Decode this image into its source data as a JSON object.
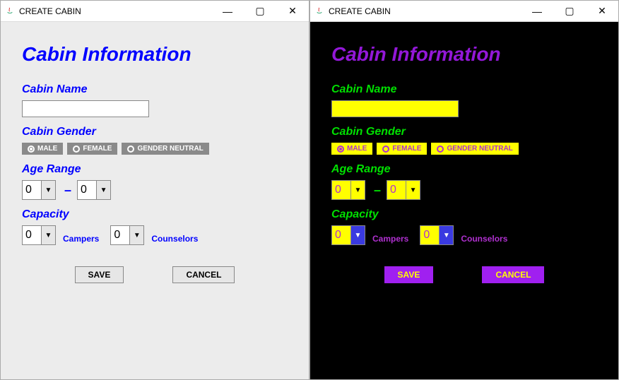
{
  "window": {
    "title": "CREATE CABIN"
  },
  "heading": "Cabin Information",
  "labels": {
    "cabin_name": "Cabin Name",
    "cabin_gender": "Cabin Gender",
    "age_range": "Age Range",
    "capacity": "Capacity",
    "campers": "Campers",
    "counselors": "Counselors",
    "dash": "–"
  },
  "inputs": {
    "cabin_name_value": ""
  },
  "gender_options": {
    "male": "MALE",
    "female": "FEMALE",
    "neutral": "GENDER NEUTRAL",
    "selected": "male"
  },
  "age_range": {
    "min": "0",
    "max": "0"
  },
  "capacity": {
    "campers": "0",
    "counselors": "0"
  },
  "buttons": {
    "save": "SAVE",
    "cancel": "CANCEL"
  }
}
